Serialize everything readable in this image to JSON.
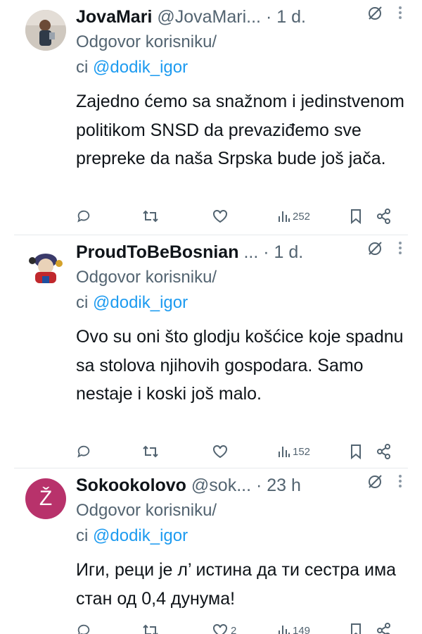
{
  "colors": {
    "accent": "#1d9bf0",
    "text": "#0f1419",
    "muted": "#536471",
    "avatar3": "#b8326b"
  },
  "tweets": [
    {
      "author_name": "JovaMari",
      "handle": "@JovaMari...",
      "separator": "·",
      "time": "1 d.",
      "reply_prefix": "Odgovor korisniku/",
      "reply_ci": "ci",
      "mention": "@dodik_igor",
      "text": "Zajedno ćemo sa snažnom i jedinstvenom politikom SNSD da prevaziđemo sve prepreke da naša Srpska bude još jača.",
      "views": "252",
      "likes": "",
      "avatar_icon": "profile-photo-avatar"
    },
    {
      "author_name": "ProudToBeBosnian",
      "handle": "...",
      "separator": "·",
      "time": "1 d.",
      "reply_prefix": "Odgovor korisniku/",
      "reply_ci": "ci",
      "mention": "@dodik_igor",
      "text": "Ovo su oni što glodju košćice koje spadnu sa stolova njihovih gospodara. Samo nestaje i koski još malo.",
      "views": "152",
      "likes": "",
      "avatar_icon": "cartoon-avatar"
    },
    {
      "author_name": "Sokookolovo",
      "handle": "@sok...",
      "separator": "·",
      "time": "23 h",
      "reply_prefix": "Odgovor korisniku/",
      "reply_ci": "ci",
      "mention": "@dodik_igor",
      "text": "Иги, реци је л’ истина да ти сестра има стан од 0,4 дунума!",
      "views": "149",
      "likes": "2",
      "avatar_letter": "Ž"
    }
  ]
}
